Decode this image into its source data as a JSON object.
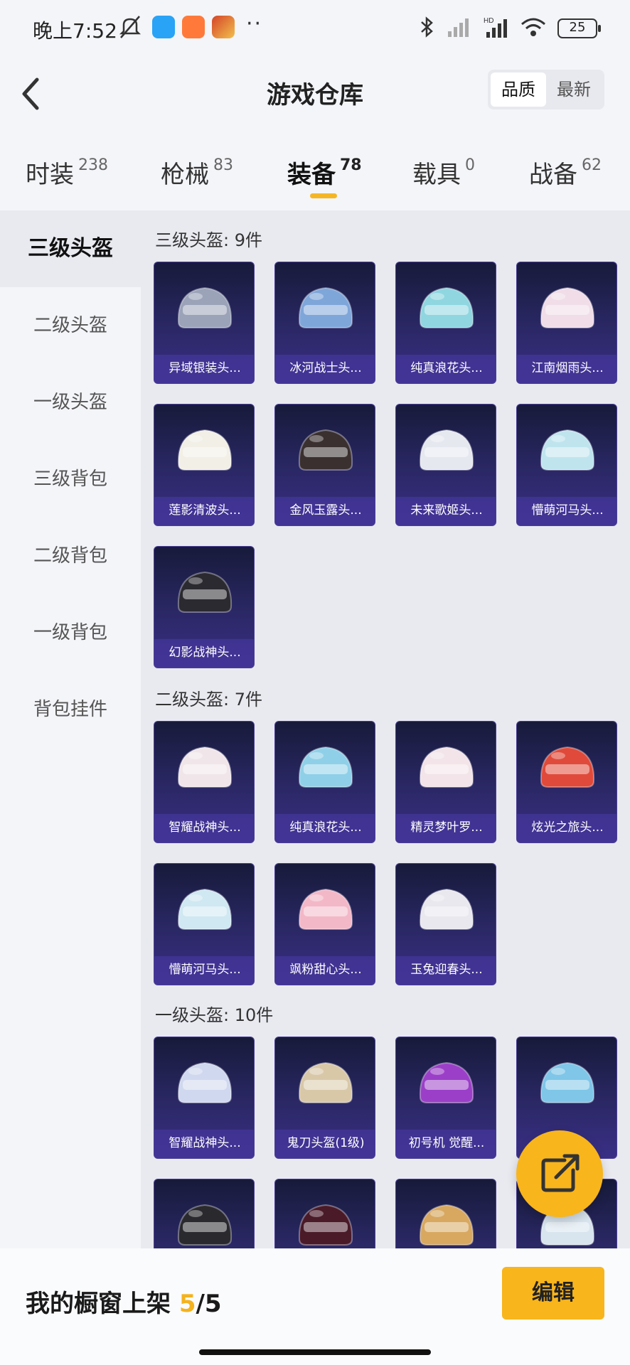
{
  "status_bar": {
    "time": "晚上7:52",
    "battery": "25"
  },
  "header": {
    "title": "游戏仓库",
    "sort_options": [
      "品质",
      "最新"
    ],
    "sort_active": "品质"
  },
  "category_tabs": [
    {
      "label": "时装",
      "count": "238"
    },
    {
      "label": "枪械",
      "count": "83"
    },
    {
      "label": "装备",
      "count": "78",
      "active": true
    },
    {
      "label": "载具",
      "count": "0"
    },
    {
      "label": "战备",
      "count": "62"
    }
  ],
  "sidebar": {
    "items": [
      {
        "label": "三级头盔",
        "active": true
      },
      {
        "label": "二级头盔"
      },
      {
        "label": "一级头盔"
      },
      {
        "label": "三级背包"
      },
      {
        "label": "二级背包"
      },
      {
        "label": "一级背包"
      },
      {
        "label": "背包挂件"
      }
    ]
  },
  "sections": [
    {
      "title": "三级头盔: 9件",
      "items": [
        "异域银装头...",
        "冰河战士头...",
        "纯真浪花头...",
        "江南烟雨头...",
        "莲影清波头...",
        "金风玉露头...",
        "未来歌姬头...",
        "懵萌河马头...",
        "幻影战神头..."
      ]
    },
    {
      "title": "二级头盔: 7件",
      "items": [
        "智耀战神头...",
        "纯真浪花头...",
        "精灵梦叶罗...",
        "炫光之旅头...",
        "懵萌河马头...",
        "飒粉甜心头...",
        "玉兔迎春头..."
      ]
    },
    {
      "title": "一级头盔: 10件",
      "items": [
        "智耀战神头...",
        "鬼刀头盔(1级)",
        "初号机 觉醒...",
        "",
        "",
        "",
        "",
        ""
      ]
    }
  ],
  "helmet_colors": {
    "s0": [
      "#9aa3b8",
      "#7fa6d9",
      "#8fd6e0",
      "#f0dde8",
      "#f2efe6",
      "#3a3030",
      "#e6e8f0",
      "#bfe4ee",
      "#2a2a30"
    ],
    "s1": [
      "#f0e6ea",
      "#8fd0e8",
      "#f2e4e8",
      "#e04a3a",
      "#cfe8f2",
      "#f3b8c8",
      "#e8e8ee"
    ],
    "s2": [
      "#cfd8ee",
      "#d9c8a8",
      "#9b3fc8",
      "#7fc6e8",
      "#2a2a2e",
      "#4a1a28",
      "#d8a860",
      "#d8e4ee"
    ]
  },
  "bottom_bar": {
    "label": "我的橱窗上架",
    "current": "5",
    "total": "/5",
    "edit_label": "编辑"
  }
}
